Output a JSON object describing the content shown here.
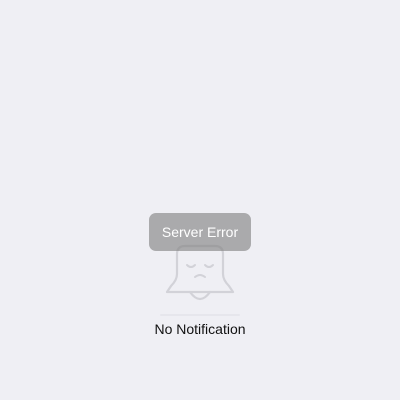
{
  "empty_state": {
    "icon": "sad-bell-icon",
    "message": "No Notification"
  },
  "toast": {
    "message": "Server Error"
  },
  "colors": {
    "background": "#efeff4",
    "icon_stroke": "#d2d2d8",
    "toast_background": "rgba(128,128,128,0.62)",
    "toast_text": "#ffffff",
    "message_text": "#111111"
  }
}
